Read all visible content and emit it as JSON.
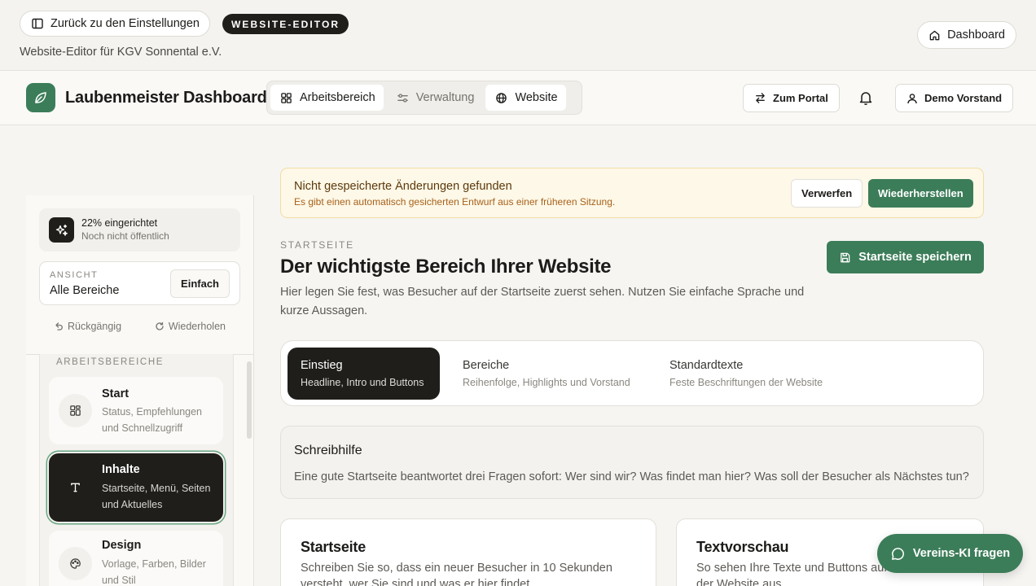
{
  "topbar": {
    "back_label": "Zurück zu den Einstellungen",
    "badge": "WEBSITE-EDITOR",
    "subtitle": "Website-Editor für KGV Sonnental e.V.",
    "dashboard_label": "Dashboard"
  },
  "header": {
    "app_title": "Laubenmeister Dashboard",
    "tabs": [
      {
        "label": "Arbeitsbereich",
        "icon": "grid-icon",
        "active": true
      },
      {
        "label": "Verwaltung",
        "icon": "sliders-icon",
        "active": false
      },
      {
        "label": "Website",
        "icon": "globe-icon",
        "active": true
      }
    ],
    "portal_label": "Zum Portal",
    "user_label": "Demo Vorstand"
  },
  "sidebar": {
    "progress_title": "22% eingerichtet",
    "progress_value": 0.22,
    "progress_sub": "Noch nicht öffentlich",
    "view_label": "ANSICHT",
    "view_value": "Alle Bereiche",
    "view_mode_button": "Einfach",
    "undo_label": "Rückgängig",
    "redo_label": "Wiederholen",
    "areas_heading": "ARBEITSBEREICHE",
    "areas": [
      {
        "title": "Start",
        "desc": "Status, Empfehlungen und Schnellzugriff",
        "icon": "dashboard-icon",
        "active": false
      },
      {
        "title": "Inhalte",
        "desc": "Startseite, Menü, Seiten und Aktuelles",
        "icon": "text-icon",
        "active": true
      },
      {
        "title": "Design",
        "desc": "Vorlage, Farben, Bilder und Stil",
        "icon": "palette-icon",
        "active": false
      }
    ]
  },
  "alert": {
    "title": "Nicht gespeicherte Änderungen gefunden",
    "text": "Es gibt einen automatisch gesicherten Entwurf aus einer früheren Sitzung.",
    "discard_label": "Verwerfen",
    "restore_label": "Wiederherstellen",
    "bg_color": "#fdf8e7"
  },
  "main": {
    "eyebrow": "STARTSEITE",
    "title": "Der wichtigste Bereich Ihrer Website",
    "description": "Hier legen Sie fest, was Besucher auf der Startseite zuerst sehen. Nutzen Sie einfache Sprache und kurze Aussagen.",
    "save_label": "Startseite speichern",
    "subtabs": [
      {
        "title": "Einstieg",
        "desc": "Headline, Intro und Buttons",
        "active": true
      },
      {
        "title": "Bereiche",
        "desc": "Reihenfolge, Highlights und Vorstand",
        "active": false
      },
      {
        "title": "Standardtexte",
        "desc": "Feste Beschriftungen der Website",
        "active": false
      }
    ],
    "help_title": "Schreibhilfe",
    "help_text": "Eine gute Startseite beantwortet drei Fragen sofort: Wer sind wir? Was findet man hier? Was soll der Besucher als Nächstes tun?",
    "card_left_title": "Startseite",
    "card_left_text": "Schreiben Sie so, dass ein neuer Besucher in 10 Sekunden versteht, wer Sie sind und was er hier findet.",
    "card_right_title": "Textvorschau",
    "card_right_text": "So sehen Ihre Texte und Buttons auf der Website aus."
  },
  "assistant": {
    "label": "Vereins-KI fragen"
  },
  "colors": {
    "accent": "#3c7d59",
    "dark": "#1f1e1b",
    "background": "#f6f5f2"
  }
}
